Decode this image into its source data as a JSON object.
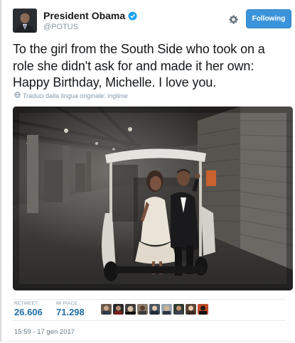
{
  "user": {
    "name": "President Obama",
    "handle": "@POTUS"
  },
  "follow_label": "Following",
  "tweet": {
    "text": "To the girl from the South Side who took on a role she didn't ask for and made it her own: Happy Birthday, Michelle. I love you.",
    "translate_note": "Traduci dalla lingua originale: inglese"
  },
  "stats": {
    "retweet_label": "RETWEET",
    "retweet_value": "26.606",
    "likes_label": "MI PIACE",
    "likes_value": "71.298"
  },
  "timestamp": "15:59 - 17 gen 2017",
  "colors": {
    "accent": "#3b94d9",
    "link": "#1f6fa8",
    "muted": "#8899a6"
  },
  "icons": [
    "verified-badge-icon",
    "gear-icon",
    "globe-icon"
  ]
}
